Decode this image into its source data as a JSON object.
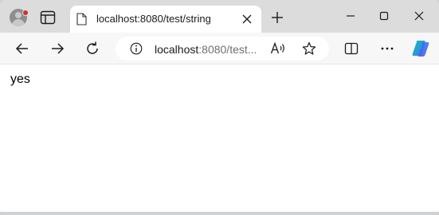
{
  "tab": {
    "title": "localhost:8080/test/string"
  },
  "address_bar": {
    "host": "localhost",
    "path": ":8080/test..."
  },
  "page": {
    "text": "yes"
  },
  "colors": {
    "profile_badge": "#d0312d",
    "copilot_blue": "#2f7bf5",
    "copilot_teal": "#18c0b0"
  },
  "icons": [
    "profile-icon",
    "tab-actions-icon",
    "page-icon",
    "close-icon",
    "plus-icon",
    "minimize-icon",
    "maximize-icon",
    "close-window-icon",
    "back-arrow-icon",
    "forward-arrow-icon",
    "refresh-icon",
    "info-icon",
    "read-aloud-icon",
    "favorite-star-icon",
    "split-screen-icon",
    "more-icon",
    "copilot-icon"
  ]
}
